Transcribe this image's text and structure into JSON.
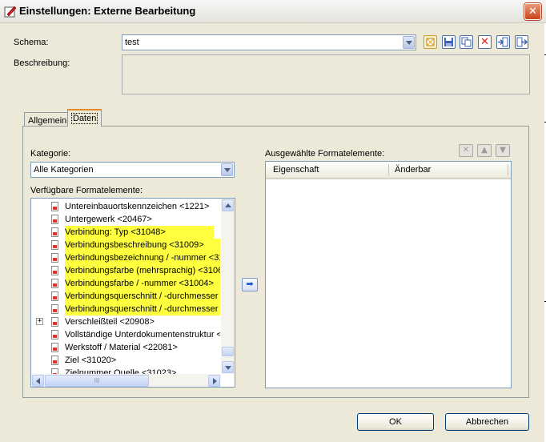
{
  "window": {
    "title": "Einstellungen: Externe Bearbeitung",
    "close_glyph": "✕",
    "icon": "edit-settings-icon"
  },
  "schema": {
    "label": "Schema:",
    "value": "test"
  },
  "beschreibung": {
    "label": "Beschreibung:",
    "value": ""
  },
  "toolbar": {
    "icons": [
      "new-schema-icon",
      "save-icon",
      "copy-icon",
      "delete-icon",
      "import-icon",
      "export-icon"
    ],
    "delete_glyph": "✕"
  },
  "tabs": [
    {
      "label": "Allgemein",
      "selected": false
    },
    {
      "label": "Daten",
      "selected": true
    }
  ],
  "kategorie": {
    "label": "Kategorie:",
    "value": "Alle Kategorien"
  },
  "available": {
    "label": "Verfügbare Formatelemente:",
    "items": [
      {
        "text": "Untereinbauortskennzeichen <1221>",
        "highlight": false
      },
      {
        "text": "Untergewerk <20467>",
        "highlight": false
      },
      {
        "text": "Verbindung: Typ <31048>",
        "highlight": true
      },
      {
        "text": "Verbindungsbeschreibung <31009>",
        "highlight": true
      },
      {
        "text": "Verbindungsbezeichnung / -nummer <31",
        "highlight": true
      },
      {
        "text": "Verbindungsfarbe (mehrsprachig) <3106",
        "highlight": true
      },
      {
        "text": "Verbindungsfarbe / -nummer <31004>",
        "highlight": true
      },
      {
        "text": "Verbindungsquerschnitt / -durchmesser <",
        "highlight": true
      },
      {
        "text": "Verbindungsquerschnitt / -durchmesser m",
        "highlight": true
      },
      {
        "text": "Verschleißteil <20908>",
        "highlight": false,
        "expandable": true
      },
      {
        "text": "Vollständige Unterdokumentenstruktur <",
        "highlight": false
      },
      {
        "text": "Werkstoff / Material <22081>",
        "highlight": false
      },
      {
        "text": "Ziel <31020>",
        "highlight": false
      },
      {
        "text": "Zielnummer Quelle <31023>",
        "highlight": false
      }
    ],
    "expand_glyph": "+",
    "hscroll_grip": "III"
  },
  "selected": {
    "label": "Ausgewählte Formatelemente:",
    "columns": [
      "Eigenschaft",
      "Änderbar"
    ],
    "rows": [],
    "tools": {
      "remove_glyph": "✕",
      "up_glyph": "▲",
      "down_glyph": "▼"
    }
  },
  "transfer": {
    "icon": "add-arrow-icon",
    "glyph": "➡"
  },
  "buttons": {
    "ok": "OK",
    "cancel": "Abbrechen"
  },
  "colors": {
    "highlight": "#ffff40",
    "window_bg": "#ece9d8",
    "field_border": "#7f9db9"
  }
}
